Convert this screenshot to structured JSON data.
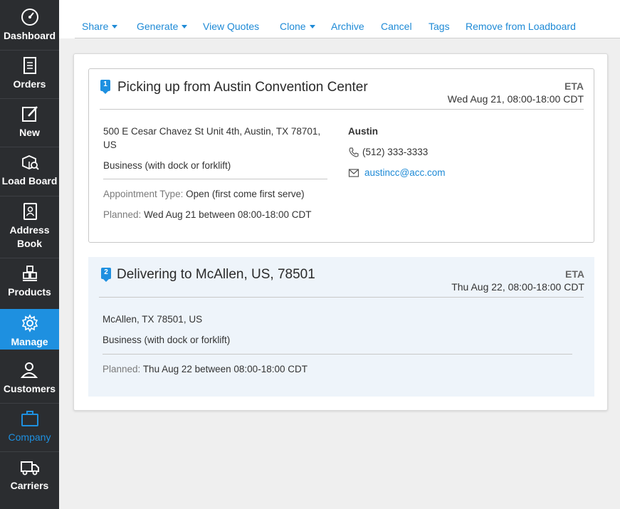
{
  "sidebar": {
    "items": [
      {
        "label": "Dashboard"
      },
      {
        "label": "Orders"
      },
      {
        "label": "New"
      },
      {
        "label": "Load Board"
      },
      {
        "label": "Address Book"
      },
      {
        "label": "Products"
      },
      {
        "label": "Manage"
      },
      {
        "label": "Customers"
      },
      {
        "label": "Company"
      },
      {
        "label": "Carriers"
      }
    ],
    "active": "Manage"
  },
  "toolbar": {
    "share": "Share",
    "generate": "Generate",
    "view_quotes": "View Quotes",
    "clone": "Clone",
    "archive": "Archive",
    "cancel": "Cancel",
    "tags": "Tags",
    "remove": "Remove from Loadboard"
  },
  "stops": [
    {
      "number": "1",
      "title": "Picking up from Austin Convention Center",
      "eta_label": "ETA",
      "eta": "Wed Aug 21, 08:00-18:00 CDT",
      "address_line1": "500 E Cesar Chavez St Unit 4th, Austin, TX 78701,",
      "address_line2": "US",
      "location_type": "Business (with dock or forklift)",
      "appointment_label": "Appointment Type:",
      "appointment_value": "Open (first come first serve)",
      "planned_label": "Planned:",
      "planned_value": "Wed Aug 21 between 08:00-18:00 CDT",
      "contact_name": "Austin",
      "phone": "(512) 333-3333",
      "email": "austincc@acc.com"
    },
    {
      "number": "2",
      "title": "Delivering to McAllen, US, 78501",
      "eta_label": "ETA",
      "eta": "Thu Aug 22, 08:00-18:00 CDT",
      "address_line1": "McAllen, TX 78501, US",
      "location_type": "Business (with dock or forklift)",
      "planned_label": "Planned:",
      "planned_value": "Thu Aug 22 between 08:00-18:00 CDT"
    }
  ],
  "colors": {
    "accent": "#1e90e0",
    "sidebar_bg": "#2b2d30",
    "link": "#1e8ad6"
  }
}
